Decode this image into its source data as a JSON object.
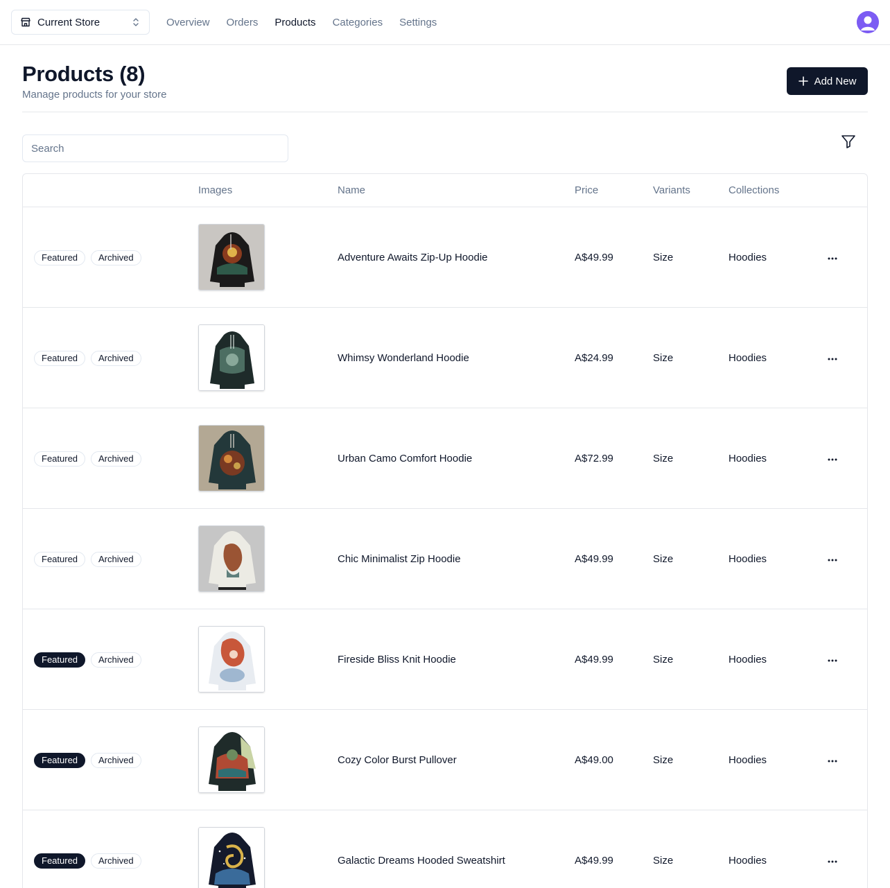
{
  "store_switcher": {
    "label": "Current Store",
    "icon": "store-icon"
  },
  "nav": [
    {
      "label": "Overview",
      "active": false
    },
    {
      "label": "Orders",
      "active": false
    },
    {
      "label": "Products",
      "active": true
    },
    {
      "label": "Categories",
      "active": false
    },
    {
      "label": "Settings",
      "active": false
    }
  ],
  "header": {
    "title": "Products (8)",
    "subtitle": "Manage products for your store",
    "add_label": "Add New"
  },
  "search": {
    "placeholder": "Search",
    "value": ""
  },
  "table": {
    "columns": [
      "",
      "Images",
      "Name",
      "Price",
      "Variants",
      "Collections"
    ],
    "rows": [
      {
        "featured_label": "Featured",
        "featured": false,
        "archived_label": "Archived",
        "name": "Adventure Awaits Zip-Up Hoodie",
        "price": "A$49.99",
        "variants": "Size",
        "collections": "Hoodies"
      },
      {
        "featured_label": "Featured",
        "featured": false,
        "archived_label": "Archived",
        "name": "Whimsy Wonderland Hoodie",
        "price": "A$24.99",
        "variants": "Size",
        "collections": "Hoodies"
      },
      {
        "featured_label": "Featured",
        "featured": false,
        "archived_label": "Archived",
        "name": "Urban Camo Comfort Hoodie",
        "price": "A$72.99",
        "variants": "Size",
        "collections": "Hoodies"
      },
      {
        "featured_label": "Featured",
        "featured": false,
        "archived_label": "Archived",
        "name": "Chic Minimalist Zip Hoodie",
        "price": "A$49.99",
        "variants": "Size",
        "collections": "Hoodies"
      },
      {
        "featured_label": "Featured",
        "featured": true,
        "archived_label": "Archived",
        "name": "Fireside Bliss Knit Hoodie",
        "price": "A$49.99",
        "variants": "Size",
        "collections": "Hoodies"
      },
      {
        "featured_label": "Featured",
        "featured": true,
        "archived_label": "Archived",
        "name": "Cozy Color Burst Pullover",
        "price": "A$49.00",
        "variants": "Size",
        "collections": "Hoodies"
      },
      {
        "featured_label": "Featured",
        "featured": true,
        "archived_label": "Archived",
        "name": "Galactic Dreams Hooded Sweatshirt",
        "price": "A$49.99",
        "variants": "Size",
        "collections": "Hoodies"
      }
    ]
  },
  "colors": {
    "primary": "#0f172a",
    "muted": "#64748b",
    "border": "#e5e7eb",
    "avatar": "#7c5cf3"
  }
}
